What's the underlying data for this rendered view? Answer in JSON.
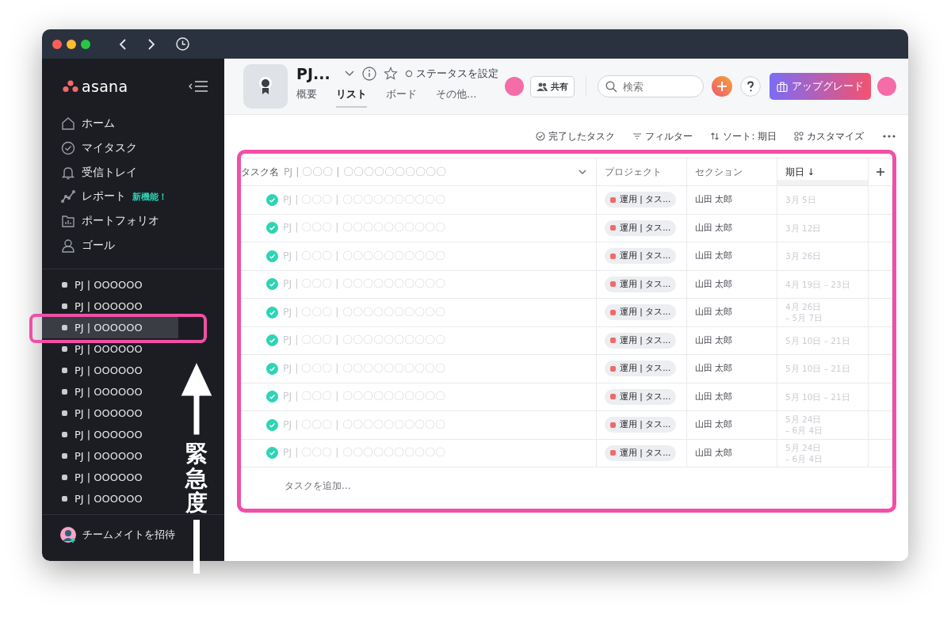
{
  "sidebar": {
    "logo": "asana",
    "nav": [
      {
        "label": "ホーム"
      },
      {
        "label": "マイタスク"
      },
      {
        "label": "受信トレイ"
      },
      {
        "label": "レポート",
        "badge": "新機能！"
      },
      {
        "label": "ポートフォリオ"
      },
      {
        "label": "ゴール"
      }
    ],
    "projects": [
      {
        "label": "PJ | OOOOOO",
        "selected": false
      },
      {
        "label": "PJ | OOOOOO",
        "selected": false
      },
      {
        "label": "PJ | OOOOOO",
        "selected": true
      },
      {
        "label": "PJ | OOOOOO",
        "selected": false
      },
      {
        "label": "PJ | OOOOOO",
        "selected": false
      },
      {
        "label": "PJ | OOOOOO",
        "selected": false
      },
      {
        "label": "PJ | OOOOOO",
        "selected": false
      },
      {
        "label": "PJ | OOOOOO",
        "selected": false
      },
      {
        "label": "PJ | OOOOOO",
        "selected": false
      },
      {
        "label": "PJ | OOOOOO",
        "selected": false
      },
      {
        "label": "PJ | OOOOOO",
        "selected": false
      }
    ],
    "invite": "チームメイトを招待"
  },
  "header": {
    "title": "PJ...",
    "status": "ステータスを設定",
    "tabs": [
      {
        "label": "概要",
        "selected": false
      },
      {
        "label": "リスト",
        "selected": true
      },
      {
        "label": "ボード",
        "selected": false
      },
      {
        "label": "その他...",
        "selected": false
      }
    ],
    "share": "共有",
    "search": {
      "placeholder": "検索"
    },
    "upgrade": "アップグレード"
  },
  "toolbar": [
    {
      "label": "完了したタスク"
    },
    {
      "label": "フィルター"
    },
    {
      "label": "ソート: 期日"
    },
    {
      "label": "カスタマイズ"
    }
  ],
  "table": {
    "name_header": "タスク名",
    "name_header_ghost": "PJ | 〇〇〇 | 〇〇〇〇〇〇〇〇〇〇",
    "columns": [
      {
        "label": "プロジェクト",
        "sorted": false
      },
      {
        "label": "セクション",
        "sorted": false
      },
      {
        "label": "期日 ↓",
        "sorted": true
      }
    ],
    "rows": [
      {
        "done": true,
        "name": "PJ | 〇〇〇 | 〇〇〇〇〇〇〇〇〇〇",
        "project": "運用 | タス...",
        "color": "#f06a6a",
        "section": "山田 太郎",
        "due": "3月 5日"
      },
      {
        "done": true,
        "name": "PJ | 〇〇〇 | 〇〇〇〇〇〇〇〇〇〇",
        "project": "運用 | タス...",
        "color": "#f06a6a",
        "section": "山田 太郎",
        "due": "3月 12日"
      },
      {
        "done": true,
        "name": "PJ | 〇〇〇 | 〇〇〇〇〇〇〇〇〇〇",
        "project": "運用 | タス...",
        "color": "#f06a6a",
        "section": "山田 太郎",
        "due": "3月 26日"
      },
      {
        "done": true,
        "name": "PJ | 〇〇〇 | 〇〇〇〇〇〇〇〇〇〇",
        "project": "運用 | タス...",
        "color": "#f06a6a",
        "section": "山田 太郎",
        "due": "4月 19日 – 23日"
      },
      {
        "done": true,
        "name": "PJ | 〇〇〇 | 〇〇〇〇〇〇〇〇〇〇",
        "project": "運用 | タス...",
        "color": "#f06a6a",
        "section": "山田 太郎",
        "due": "4月 26日\n– 5月 7日"
      },
      {
        "done": true,
        "name": "PJ | 〇〇〇 | 〇〇〇〇〇〇〇〇〇〇",
        "project": "運用 | タス...",
        "color": "#f06a6a",
        "section": "山田 太郎",
        "due": "5月 10日 – 21日"
      },
      {
        "done": true,
        "name": "PJ | 〇〇〇 | 〇〇〇〇〇〇〇〇〇〇",
        "project": "運用 | タス...",
        "color": "#f06a6a",
        "section": "山田 太郎",
        "due": "5月 10日 – 21日"
      },
      {
        "done": true,
        "name": "PJ | 〇〇〇 | 〇〇〇〇〇〇〇〇〇〇",
        "project": "運用 | タス...",
        "color": "#f06a6a",
        "section": "山田 太郎",
        "due": "5月 10日 – 21日"
      },
      {
        "done": true,
        "name": "PJ | 〇〇〇 | 〇〇〇〇〇〇〇〇〇〇",
        "project": "運用 | タス...",
        "color": "#f06a6a",
        "section": "山田 太郎",
        "due": "5月 24日\n– 6月 4日"
      },
      {
        "done": true,
        "name": "PJ | 〇〇〇 | 〇〇〇〇〇〇〇〇〇〇",
        "project": "運用 | タス...",
        "color": "#f06a6a",
        "section": "山田 太郎",
        "due": "5月 24日\n– 6月 4日"
      }
    ],
    "add_task": "タスクを追加..."
  },
  "annotation": {
    "label": "緊急度"
  }
}
